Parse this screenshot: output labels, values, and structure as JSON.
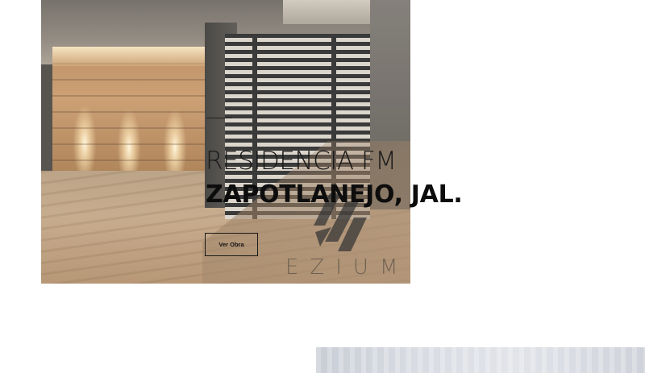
{
  "hero": {
    "project_name": "RESIDENCIA FM",
    "location": "ZAPOTLANEJO, JAL.",
    "cta_label": "Ver Obra",
    "watermark_text": "EZIUM"
  },
  "icons": {
    "logo": "ezium-logo-mark"
  }
}
